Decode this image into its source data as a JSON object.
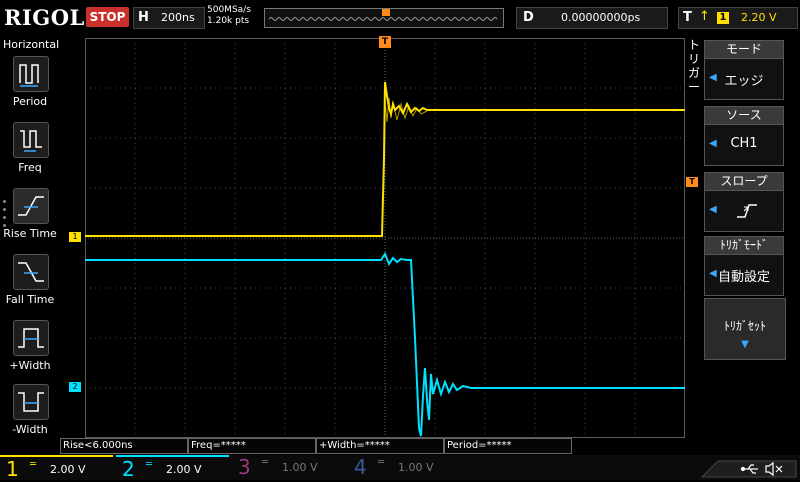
{
  "topbar": {
    "brand": "RIGOL",
    "run_state": "STOP",
    "h_label": "H",
    "timebase": "200ns",
    "sample_rate": "500MSa/s",
    "memory_depth": "1.20k pts",
    "d_label": "D",
    "delay": "0.00000000ps",
    "t_label": "T",
    "trigger_source": "1",
    "trigger_level": "2.20 V"
  },
  "left_panel": {
    "title": "Horizontal",
    "items": [
      {
        "label": "Period"
      },
      {
        "label": "Freq"
      },
      {
        "label": "Rise Time"
      },
      {
        "label": "Fall Time"
      },
      {
        "label": "+Width"
      },
      {
        "label": "-Width"
      }
    ]
  },
  "right_panel": {
    "title_vertical": [
      "ト",
      "リ",
      "ガ",
      "ー"
    ],
    "menus": [
      {
        "header": "モード",
        "value": "エッジ"
      },
      {
        "header": "ソース",
        "value": "CH1"
      },
      {
        "header": "スロープ",
        "value": ""
      },
      {
        "header": "ﾄﾘｶﾞﾓｰﾄﾞ",
        "value": "自動設定"
      }
    ],
    "button": "ﾄﾘｶﾞｾｯﾄ"
  },
  "measurements": [
    {
      "text": "Rise<6.000ns"
    },
    {
      "text": "Freq=*****"
    },
    {
      "text": "+Width=*****"
    },
    {
      "text": "Period=*****"
    }
  ],
  "channels": [
    {
      "num": "1",
      "scale": "2.00 V",
      "color": "#ffe000",
      "active": true
    },
    {
      "num": "2",
      "scale": "2.00 V",
      "color": "#00e0ff",
      "active": true
    },
    {
      "num": "3",
      "scale": "1.00 V",
      "color": "#9a3a7a",
      "active": false
    },
    {
      "num": "4",
      "scale": "1.00 V",
      "color": "#3a5a9a",
      "active": false
    }
  ],
  "markers": {
    "ch1": "1",
    "ch2": "2",
    "trigger": "T"
  },
  "colors": {
    "ch1": "#ffe000",
    "ch2": "#00e0ff",
    "trigger": "#ff8c1a",
    "grid": "#5a5a5a",
    "accent": "#3aa8ff"
  }
}
